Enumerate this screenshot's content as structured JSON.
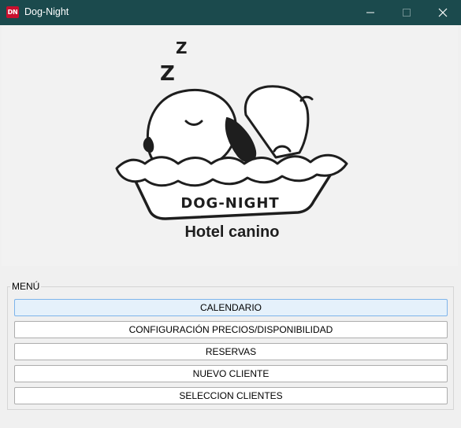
{
  "window": {
    "title": "Dog-Night",
    "icon_text": "DN",
    "icon_color": "#c8102e",
    "titlebar_color": "#1b4a4d",
    "controls": [
      "minimize-icon",
      "maximize-icon",
      "close-icon"
    ]
  },
  "logo": {
    "sleep_letters": [
      "Z",
      "Z"
    ],
    "bed_text": "DOG-NIGHT",
    "subtitle": "Hotel canino"
  },
  "menu": {
    "legend": "MENÚ",
    "items": [
      {
        "label": "CALENDARIO",
        "active": true
      },
      {
        "label": "CONFIGURACIÓN PRECIOS/DISPONIBILIDAD",
        "active": false
      },
      {
        "label": "RESERVAS",
        "active": false
      },
      {
        "label": "NUEVO CLIENTE",
        "active": false
      },
      {
        "label": "SELECCION CLIENTES",
        "active": false
      }
    ]
  }
}
